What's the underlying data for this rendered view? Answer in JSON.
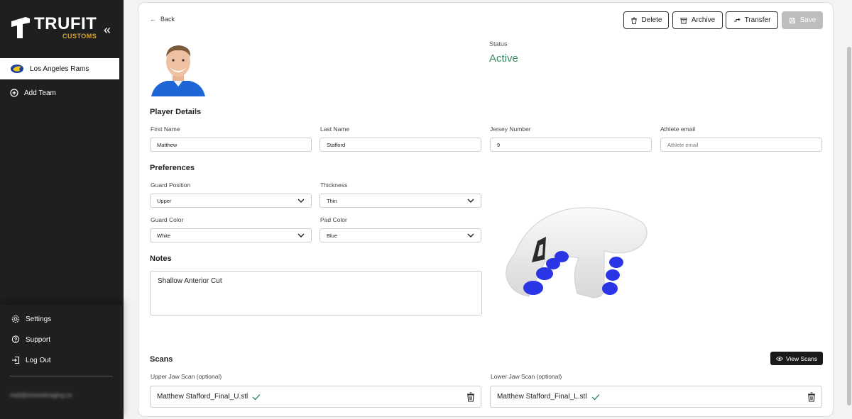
{
  "brand": {
    "title": "TRUFIT",
    "subtitle": "CUSTOMS",
    "accent": "#d8a733"
  },
  "sidebar": {
    "collapse_icon": "«",
    "team": "Los Angeles Rams",
    "add_team": "Add Team",
    "bottom": {
      "settings": "Settings",
      "support": "Support",
      "logout": "Log Out",
      "email": "matt@sharedimaging.ca"
    }
  },
  "header": {
    "back": "Back",
    "delete": "Delete",
    "archive": "Archive",
    "transfer": "Transfer",
    "save": "Save"
  },
  "status": {
    "label": "Status",
    "value": "Active",
    "color": "#3c8a62"
  },
  "player_details": {
    "title": "Player Details",
    "first_name_label": "First Name",
    "first_name": "Matthew",
    "last_name_label": "Last Name",
    "last_name": "Stafford",
    "jersey_label": "Jersey Number",
    "jersey": "9",
    "email_label": "Athlete email",
    "email_placeholder": "Athlete email"
  },
  "preferences": {
    "title": "Preferences",
    "guard_position_label": "Guard Position",
    "guard_position": "Upper",
    "thickness_label": "Thickness",
    "thickness": "Thin",
    "guard_color_label": "Guard Color",
    "guard_color": "White",
    "pad_color_label": "Pad Color",
    "pad_color": "Blue"
  },
  "notes": {
    "title": "Notes",
    "value": "Shallow Anterior Cut"
  },
  "scans": {
    "title": "Scans",
    "view_button": "View Scans",
    "upper_label": "Upper Jaw Scan (optional)",
    "upper_file": "Matthew Stafford_Final_U.stl",
    "lower_label": "Lower Jaw Scan (optional)",
    "lower_file": "Matthew Stafford_Final_L.stl"
  }
}
